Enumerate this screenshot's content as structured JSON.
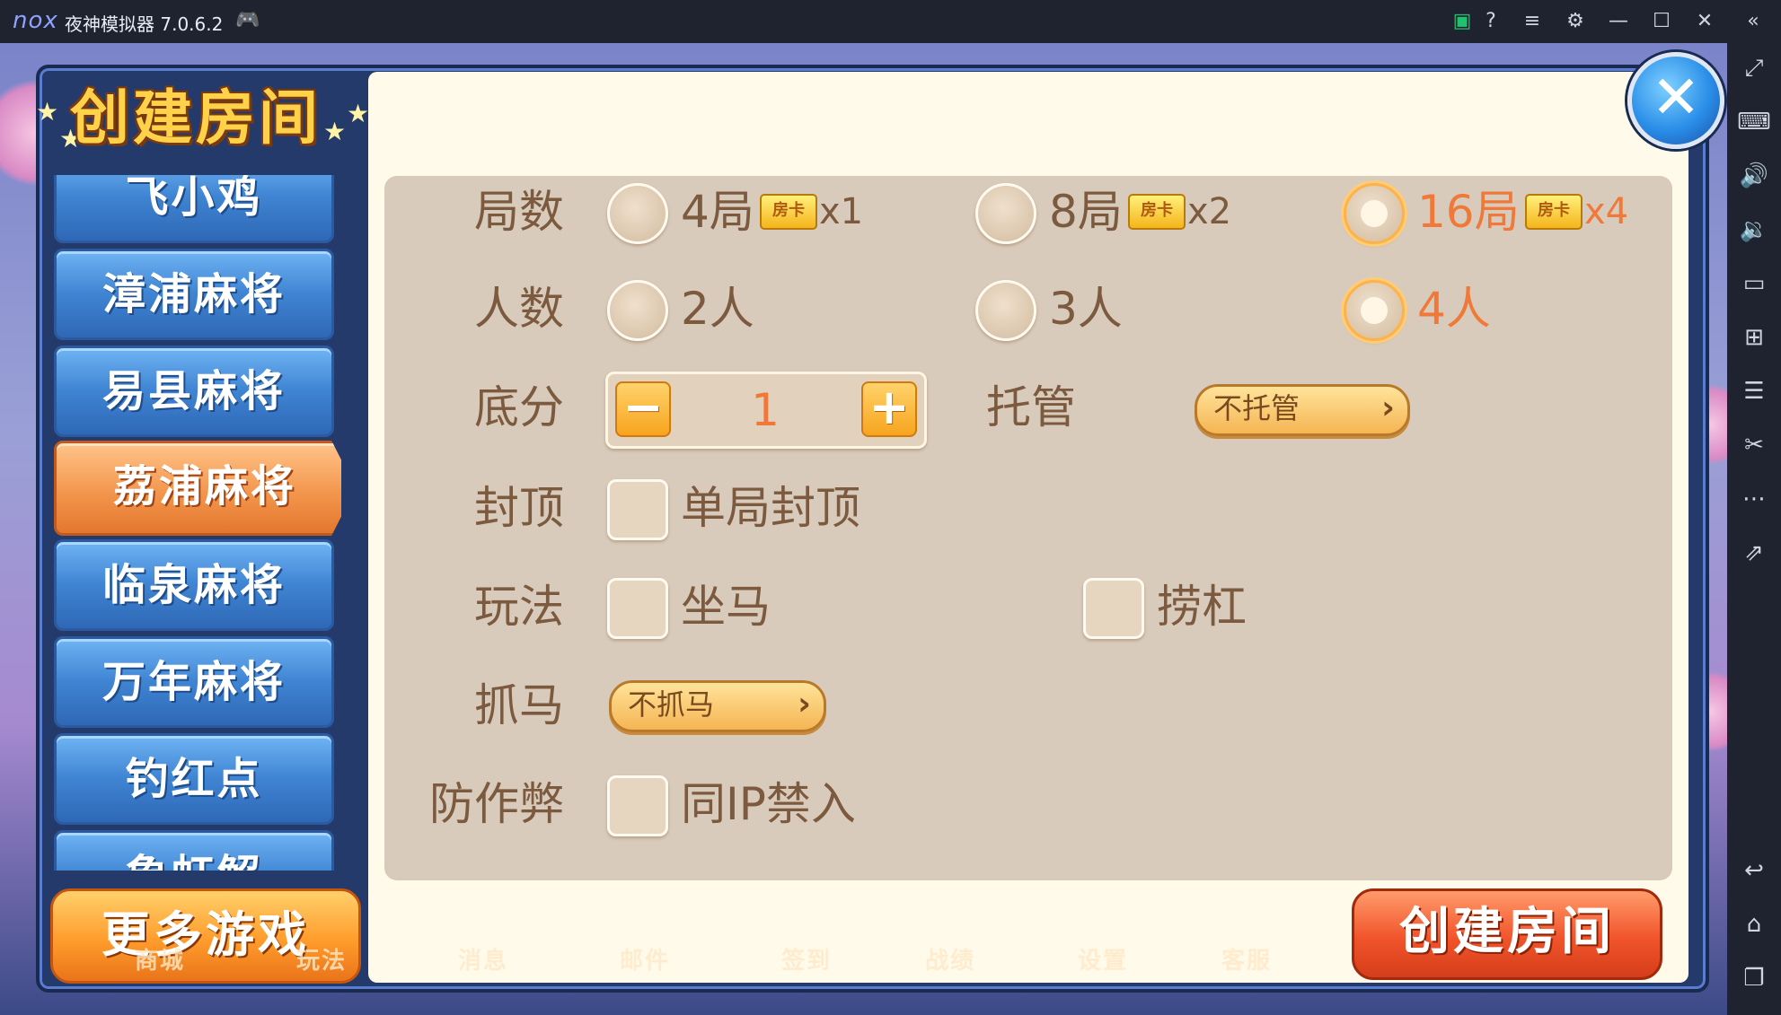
{
  "emulator": {
    "logo": "nox",
    "title": "夜神模拟器 7.0.6.2",
    "titlebar_icons": [
      "gamepad-icon",
      "shop-icon",
      "help-icon",
      "menu-icon",
      "settings-icon",
      "minimize-icon",
      "maximize-icon",
      "close-icon",
      "collapse-icon"
    ],
    "sidebar_icons": [
      "fullscreen-icon",
      "keyboard-icon",
      "volume-up-icon",
      "volume-down-icon",
      "screen-icon",
      "apk-install-icon",
      "multi-instance-icon",
      "screenshot-icon",
      "more-icon",
      "share-icon",
      "back-icon",
      "home-icon",
      "recent-apps-icon"
    ]
  },
  "dialog": {
    "title": "创建房间",
    "close_icon": "close-icon",
    "game_list": [
      "飞小鸡",
      "漳浦麻将",
      "易县麻将",
      "荔浦麻将",
      "临泉麻将",
      "万年麻将",
      "钓红点",
      "象虹解"
    ],
    "active_game": "荔浦麻将",
    "more_games": "更多游戏",
    "create_button": "创建房间",
    "rows": {
      "rounds": {
        "label": "局数",
        "options": [
          {
            "text": "4局",
            "card": "房卡",
            "mult": "x1",
            "selected": false
          },
          {
            "text": "8局",
            "card": "房卡",
            "mult": "x2",
            "selected": false
          },
          {
            "text": "16局",
            "card": "房卡",
            "mult": "x4",
            "selected": true
          }
        ]
      },
      "players": {
        "label": "人数",
        "options": [
          {
            "text": "2人",
            "selected": false
          },
          {
            "text": "3人",
            "selected": false
          },
          {
            "text": "4人",
            "selected": true
          }
        ]
      },
      "base_score": {
        "label": "底分",
        "minus": "−",
        "value": "1",
        "plus": "+"
      },
      "trustee": {
        "label": "托管",
        "value": "不托管"
      },
      "cap": {
        "label": "封顶",
        "option": "单局封顶",
        "checked": false
      },
      "rules": {
        "label": "玩法",
        "options": [
          {
            "text": "坐马",
            "checked": false
          },
          {
            "text": "捞杠",
            "checked": false
          }
        ]
      },
      "catch_horse": {
        "label": "抓马",
        "value": "不抓马"
      },
      "anti_cheat": {
        "label": "防作弊",
        "option": "同IP禁入",
        "checked": false
      }
    }
  },
  "background_nav": [
    "商城",
    "玩法",
    "消息",
    "邮件",
    "签到",
    "战绩",
    "设置",
    "客服"
  ],
  "colors": {
    "selected_text": "#f0793a",
    "label_text": "#7c5a3f",
    "panel_bg": "#d9cbbb"
  }
}
